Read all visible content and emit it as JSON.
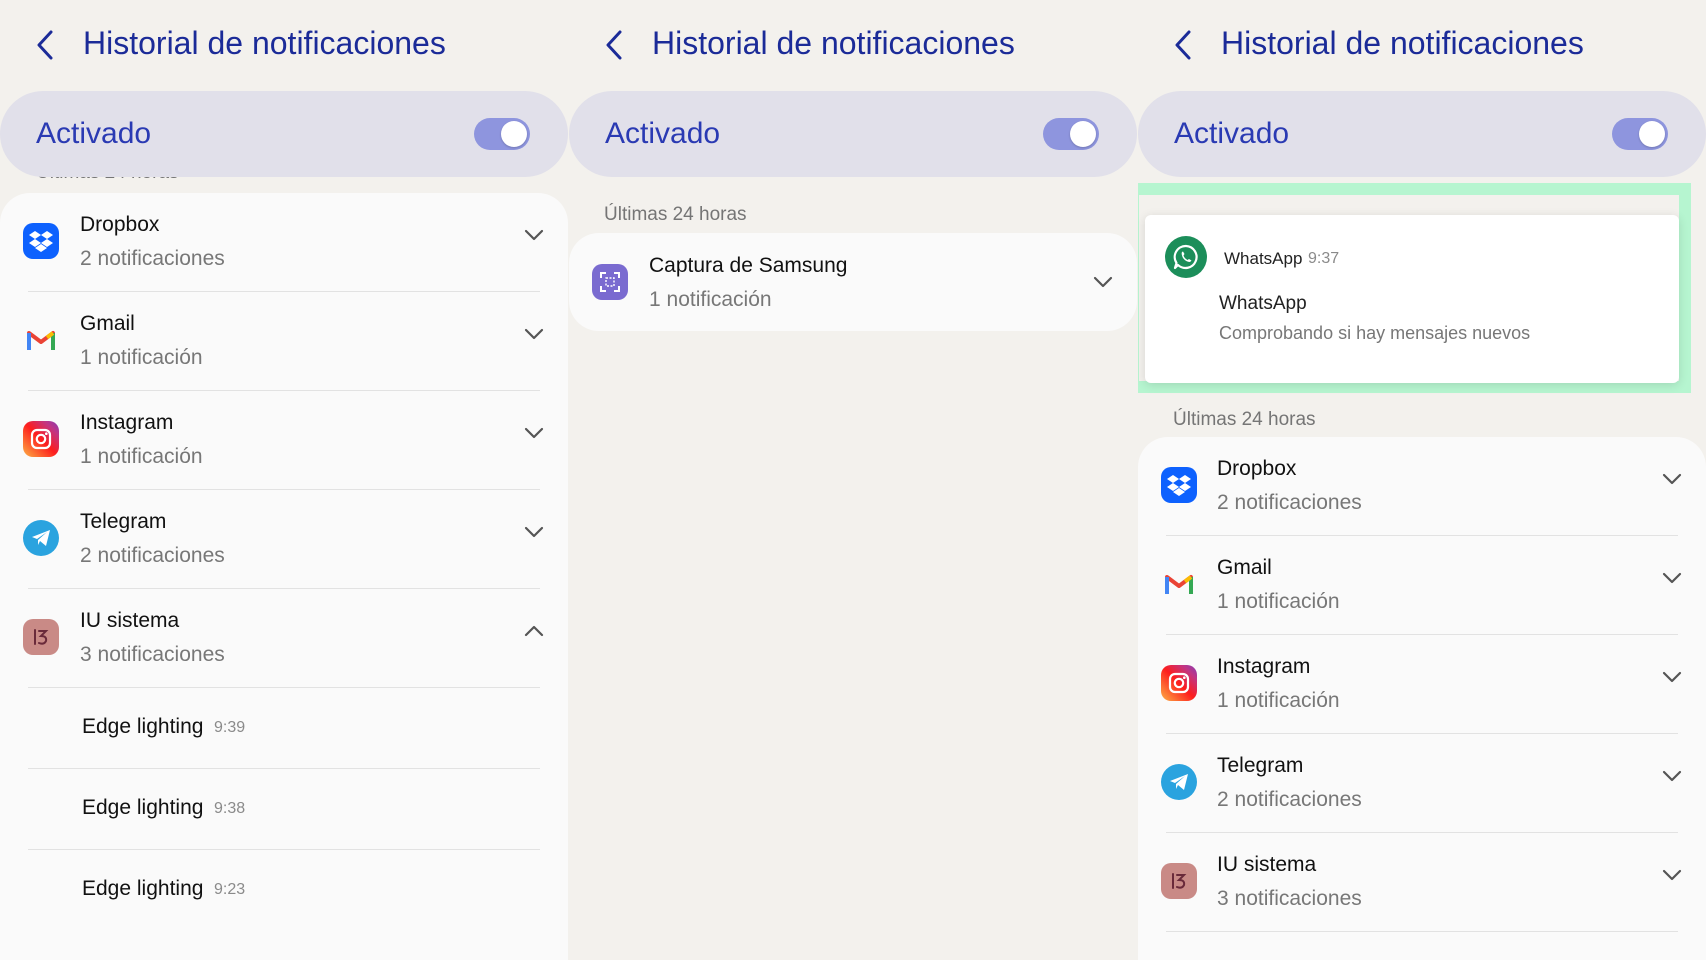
{
  "common": {
    "title": "Historial de notificaciones",
    "activado": "Activado",
    "section_label": "Últimas 24 horas"
  },
  "panel1": {
    "apps": [
      {
        "name": "Dropbox",
        "count": "2 notificaciones"
      },
      {
        "name": "Gmail",
        "count": "1 notificación"
      },
      {
        "name": "Instagram",
        "count": "1 notificación"
      },
      {
        "name": "Telegram",
        "count": "2 notificaciones"
      },
      {
        "name": "IU sistema",
        "count": "3 notificaciones"
      }
    ],
    "sub_items": [
      {
        "name": "Edge lighting",
        "time": "9:39"
      },
      {
        "name": "Edge lighting",
        "time": "9:38"
      },
      {
        "name": "Edge lighting",
        "time": "9:23"
      }
    ]
  },
  "panel2": {
    "apps": [
      {
        "name": "Captura de Samsung",
        "count": "1 notificación"
      }
    ]
  },
  "panel3": {
    "whatsapp_card": {
      "app": "WhatsApp",
      "time": "9:37",
      "title": "WhatsApp",
      "body": "Comprobando si hay mensajes nuevos"
    },
    "apps": [
      {
        "name": "Dropbox",
        "count": "2 notificaciones"
      },
      {
        "name": "Gmail",
        "count": "1 notificación"
      },
      {
        "name": "Instagram",
        "count": "1 notificación"
      },
      {
        "name": "Telegram",
        "count": "2 notificaciones"
      },
      {
        "name": "IU sistema",
        "count": "3 notificaciones"
      }
    ]
  },
  "colors": {
    "title": "#1b2b98",
    "toggle": "#8e95de",
    "highlight": "#b6f5d0",
    "whatsapp": "#1c8e5a"
  }
}
